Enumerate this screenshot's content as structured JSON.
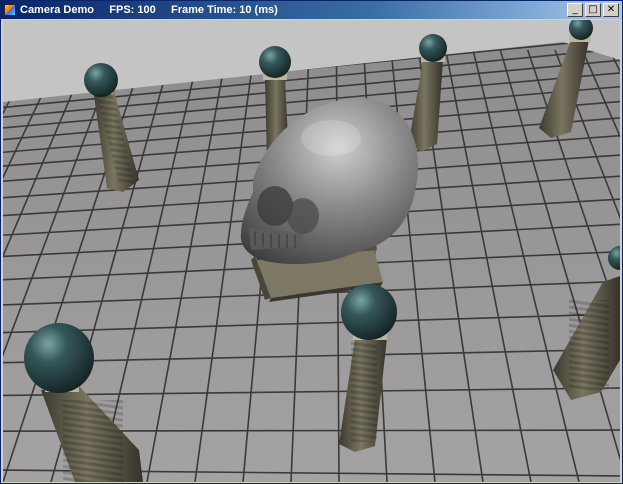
{
  "window": {
    "title": "Camera Demo     FPS: 100     Frame Time: 10 (ms)",
    "buttons": {
      "minimize": "_",
      "maximize": "□",
      "close": "✕"
    }
  },
  "colors": {
    "title_bar": "#0a246a",
    "floor": "#9a9898",
    "grout": "#3a3a3a",
    "sky": "#c4c4c4",
    "pillar": "#5e5a4a",
    "orb": "#2e4a48",
    "skull": "#8a8a8a"
  },
  "scene": {
    "objects": [
      "tile-floor",
      "skull-statue",
      "stone-pedestal",
      "pillar-orb"
    ]
  }
}
